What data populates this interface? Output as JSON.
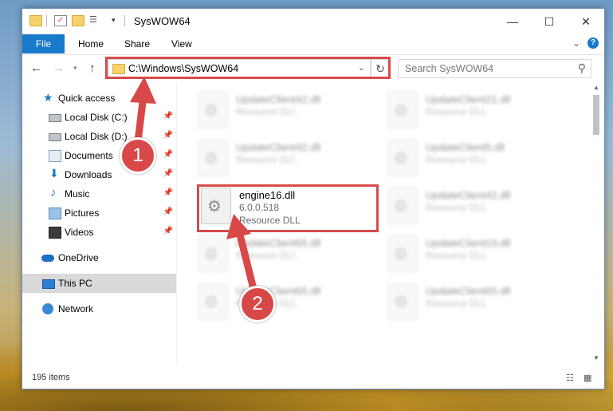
{
  "window": {
    "title": "SysWOW64",
    "minimize": "—",
    "maximize": "☐",
    "close": "✕"
  },
  "ribbon": {
    "tabs": [
      "File",
      "Home",
      "Share",
      "View"
    ],
    "help": "?"
  },
  "address": {
    "path": "C:\\Windows\\SysWOW64",
    "search_placeholder": "Search SysWOW64"
  },
  "nav": {
    "items": [
      {
        "label": "Quick access",
        "icon": "star-icon"
      },
      {
        "label": "Local Disk (C:)",
        "icon": "drive-icon",
        "pinned": true
      },
      {
        "label": "Local Disk (D:)",
        "icon": "drive-icon",
        "pinned": true
      },
      {
        "label": "Documents",
        "icon": "documents-icon",
        "pinned": true
      },
      {
        "label": "Downloads",
        "icon": "download-icon",
        "pinned": true
      },
      {
        "label": "Music",
        "icon": "music-icon",
        "pinned": true
      },
      {
        "label": "Pictures",
        "icon": "pictures-icon",
        "pinned": true
      },
      {
        "label": "Videos",
        "icon": "videos-icon",
        "pinned": true
      },
      {
        "label": "OneDrive",
        "icon": "cloud-icon"
      },
      {
        "label": "This PC",
        "icon": "pc-icon",
        "selected": true
      },
      {
        "label": "Network",
        "icon": "network-icon"
      }
    ]
  },
  "files": [
    {
      "name": "UpdateClient42.dll",
      "type": "Resource DLL",
      "blurred": true
    },
    {
      "name": "UpdateClient21.dll",
      "type": "Resource DLL",
      "blurred": true
    },
    {
      "name": "UpdateClient42.dll",
      "type": "Resource DLL",
      "blurred": true
    },
    {
      "name": "UpdateClient5.dll",
      "type": "Resource DLL",
      "blurred": true
    },
    {
      "name": "engine16.dll",
      "version": "6.0.0.518",
      "type": "Resource DLL",
      "blurred": false
    },
    {
      "name": "UpdateClient42.dll",
      "type": "Resource DLL",
      "blurred": true
    },
    {
      "name": "UpdateClient65.dll",
      "type": "Resource DLL",
      "blurred": true
    },
    {
      "name": "UpdateClient19.dll",
      "type": "Resource DLL",
      "blurred": true
    },
    {
      "name": "UpdateClient65.dll",
      "type": "Resource DLL",
      "blurred": true
    },
    {
      "name": "UpdateClient65.dll",
      "type": "Resource DLL",
      "blurred": true
    }
  ],
  "status": {
    "items_count": "195 items"
  },
  "annotations": {
    "marker1": "1",
    "marker2": "2",
    "highlight_color": "#d94a4a"
  }
}
